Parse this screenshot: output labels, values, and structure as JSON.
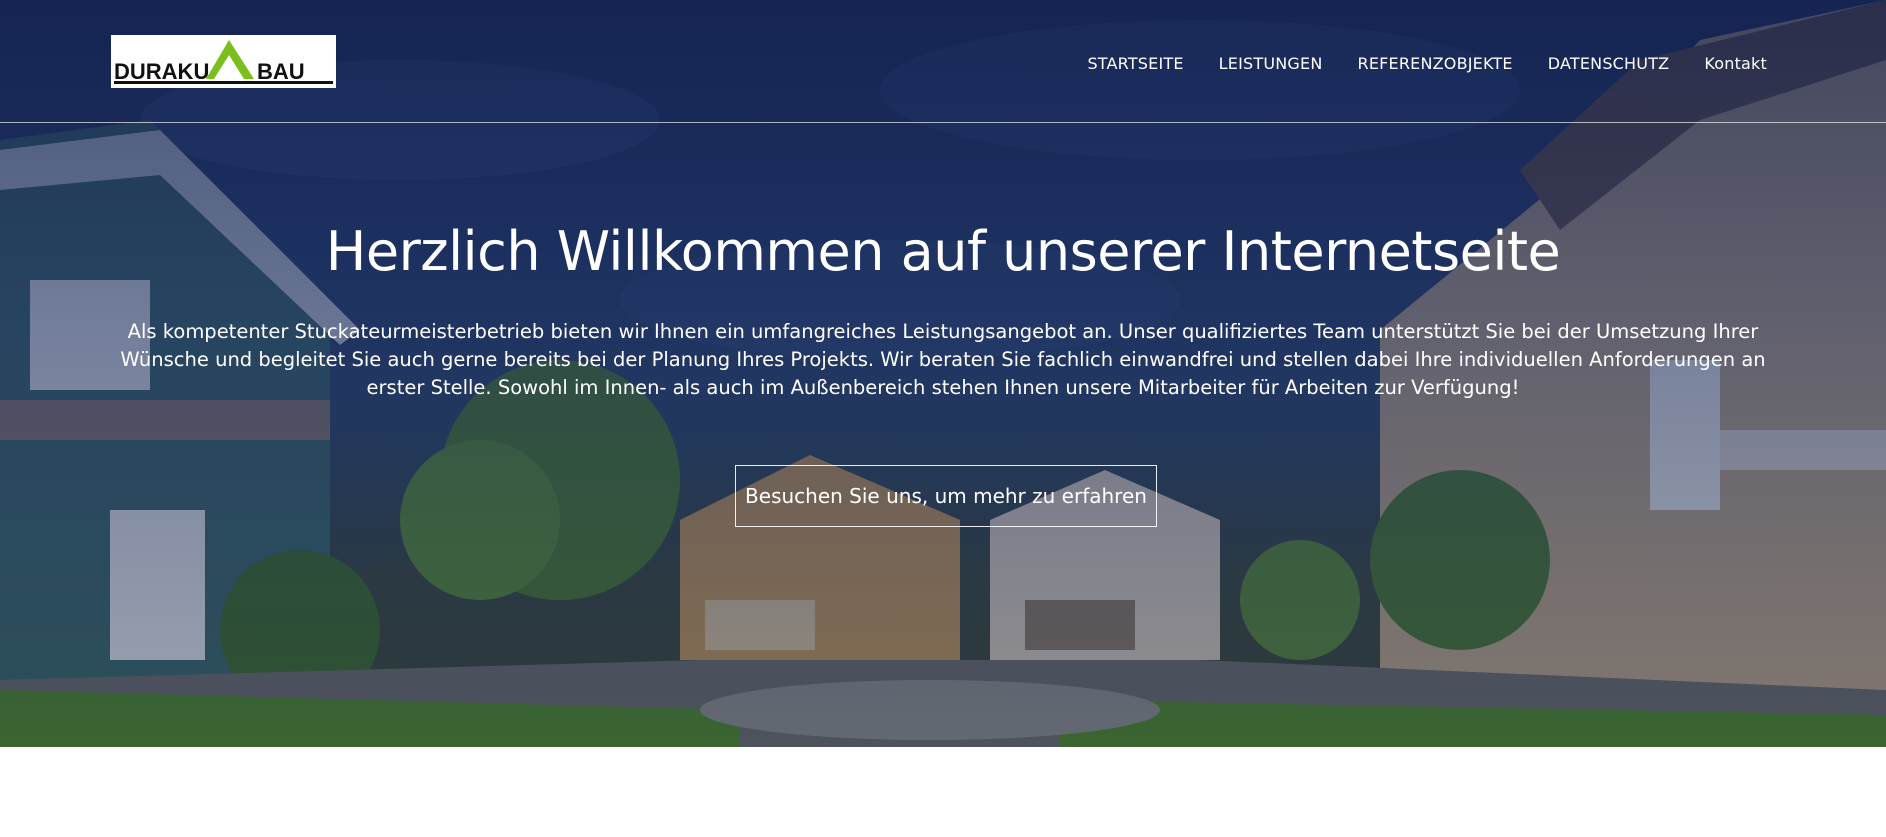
{
  "logo": {
    "text_left": "DURAKU",
    "text_right": "BAU",
    "accent_color": "#7bbf1e"
  },
  "nav": {
    "items": [
      "STARTSEITE",
      "LEISTUNGEN",
      "REFERENZOBJEKTE",
      "DATENSCHUTZ",
      "Kontakt"
    ]
  },
  "hero": {
    "title": "Herzlich Willkommen auf unserer Internetseite",
    "text": "Als kompetenter Stuckateurmeisterbetrieb bieten wir Ihnen ein umfangreiches Leistungsangebot an. Unser qualifiziertes Team unterstützt Sie bei der Umsetzung Ihrer Wünsche und begleitet Sie auch gerne bereits bei der Planung Ihres Projekts. Wir beraten Sie fachlich einwandfrei und stellen dabei Ihre individuellen Anforderungen an erster Stelle. Sowohl im Innen- als auch im Außenbereich stehen Ihnen unsere Mitarbeiter für Arbeiten zur Verfügung!",
    "cta_label": "Besuchen Sie uns, um mehr zu erfahren",
    "overlay_color": "#1a2a5e"
  }
}
